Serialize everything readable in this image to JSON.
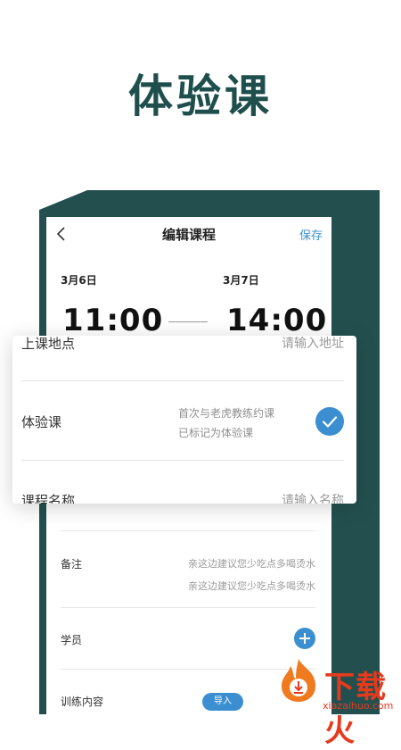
{
  "hero": {
    "title": "体验课"
  },
  "nav": {
    "title": "编辑课程",
    "save_label": "保存"
  },
  "schedule": {
    "start_date": "3月6日",
    "end_date": "3月7日",
    "start_time": "11:00",
    "end_time": "14:00"
  },
  "card": {
    "location_label": "上课地点",
    "location_placeholder": "请输入地址",
    "trial_label": "体验课",
    "trial_desc_line1": "首次与老虎教练约课",
    "trial_desc_line2": "已标记为体验课",
    "course_name_label": "课程名称",
    "course_name_placeholder": "请输入名称"
  },
  "form": {
    "note_label": "备注",
    "note_line1": "亲这边建议您少吃点多喝烫水",
    "note_line2": "亲这边建议您少吃点多喝烫水",
    "students_label": "学员",
    "training_label": "训练内容",
    "import_label": "导入"
  },
  "watermark": {
    "cn": "下载火",
    "en": "xiazaihuo.com"
  },
  "colors": {
    "brand_dark": "#23504f",
    "title_text": "#1f4f4d",
    "accent_blue": "#3b8fd0",
    "watermark_red": "#e53a1e"
  },
  "icons": {
    "back": "chevron-left-icon",
    "check": "check-circle-icon",
    "add": "plus-circle-icon"
  }
}
